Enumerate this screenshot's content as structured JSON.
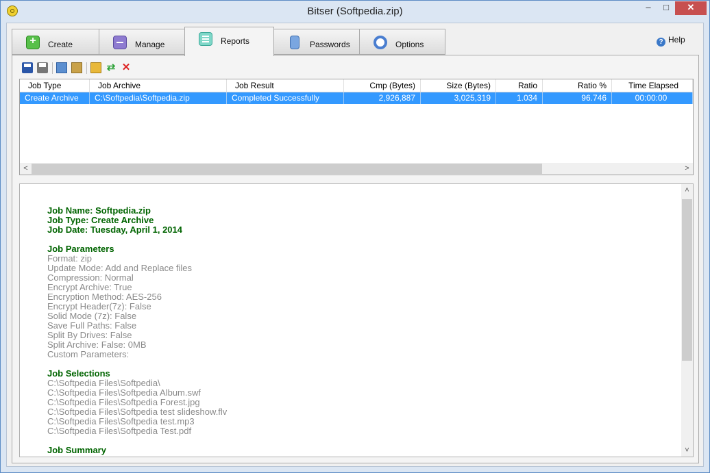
{
  "window": {
    "title": "Bitser (Softpedia.zip)",
    "min": "–",
    "max": "□",
    "close": "✕"
  },
  "tabs": [
    {
      "label": "Create",
      "icon": "create-icon"
    },
    {
      "label": "Manage",
      "icon": "manage-icon"
    },
    {
      "label": "Reports",
      "icon": "reports-icon",
      "active": true
    },
    {
      "label": "Passwords",
      "icon": "passwords-icon"
    },
    {
      "label": "Options",
      "icon": "options-icon"
    }
  ],
  "help": {
    "label": "Help"
  },
  "grid": {
    "columns": [
      "Job Type",
      "Job Archive",
      "Job Result",
      "Cmp (Bytes)",
      "Size (Bytes)",
      "Ratio",
      "Ratio %",
      "Time Elapsed"
    ],
    "rows": [
      [
        "Create Archive",
        "C:\\Softpedia\\Softpedia.zip",
        "Completed Successfully",
        "2,926,887",
        "3,025,319",
        "1.034",
        "96.746",
        "00:00:00"
      ]
    ]
  },
  "report": {
    "job_name": "Job Name: Softpedia.zip",
    "job_type": "Job Type: Create Archive",
    "job_date": "Job Date: Tuesday, April 1, 2014",
    "params_heading": "Job Parameters",
    "params": [
      "Format: zip",
      "Update Mode: Add and Replace files",
      "Compression: Normal",
      "Encrypt Archive: True",
      "Encryption Method: AES-256",
      "Encrypt Header(7z): False",
      "Solid Mode (7z): False",
      "Save Full Paths: False",
      "Split By Drives: False",
      "Split Archive: False: 0MB",
      "Custom Parameters:"
    ],
    "selections_heading": "Job Selections",
    "selections": [
      "C:\\Softpedia Files\\Softpedia\\",
      "C:\\Softpedia Files\\Softpedia Album.swf",
      "C:\\Softpedia Files\\Softpedia Forest.jpg",
      "C:\\Softpedia Files\\Softpedia test slideshow.flv",
      "C:\\Softpedia Files\\Softpedia test.mp3",
      "C:\\Softpedia Files\\Softpedia Test.pdf"
    ],
    "summary_heading": "Job Summary"
  }
}
